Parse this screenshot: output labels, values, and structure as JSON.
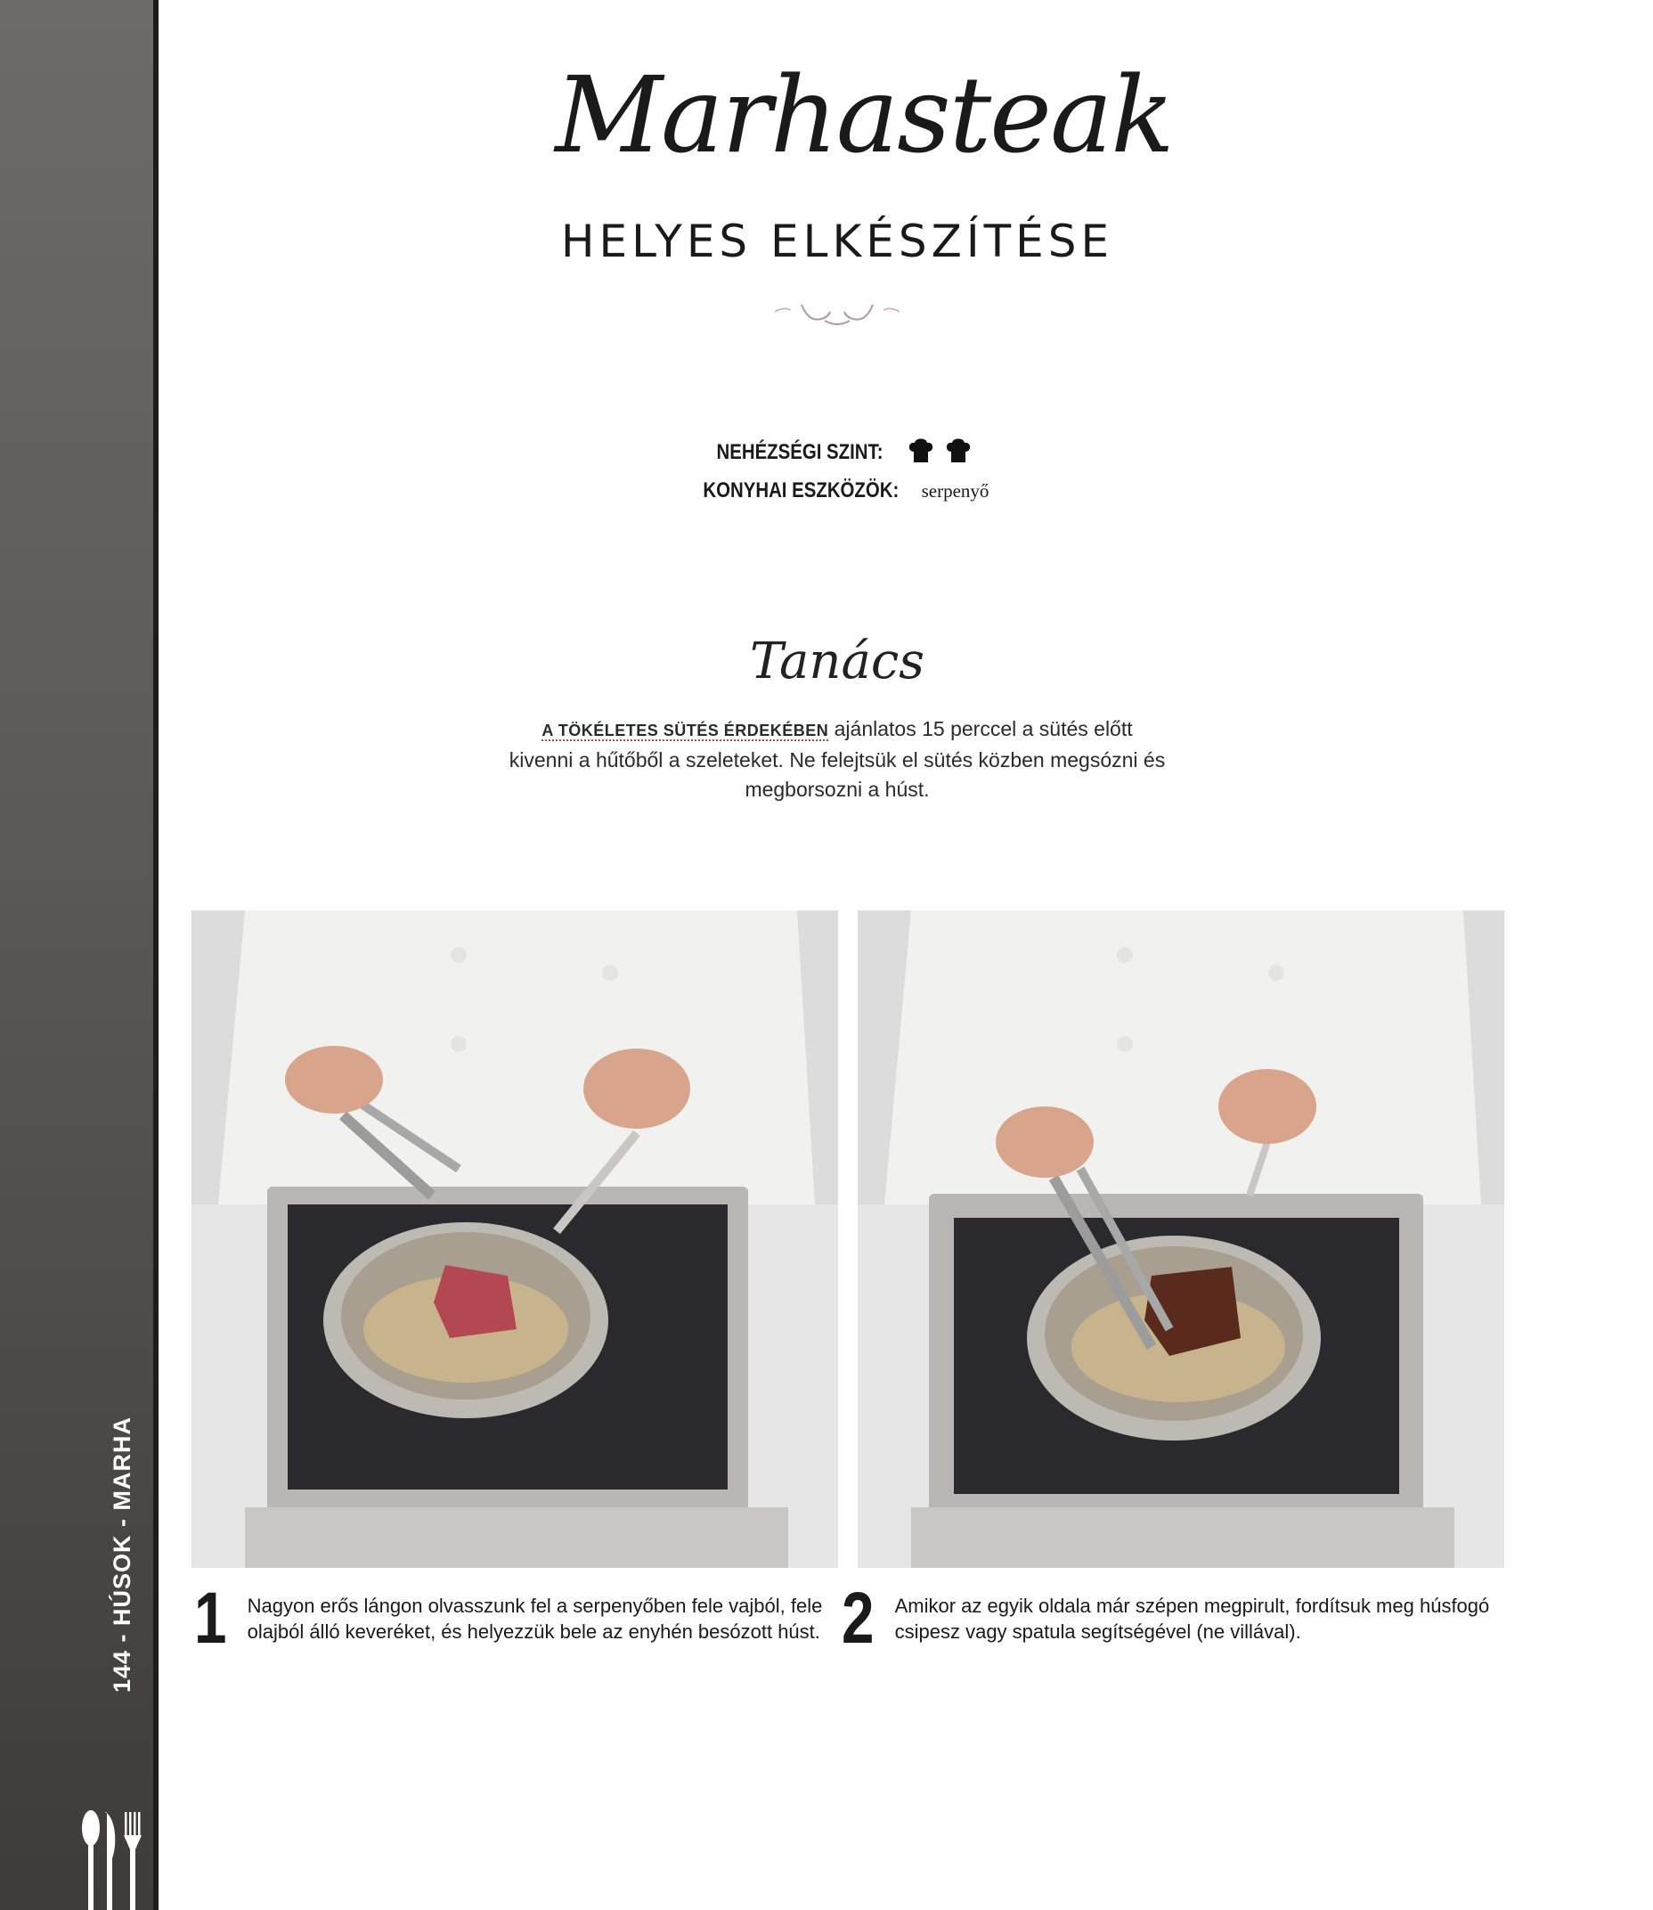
{
  "sidebar": {
    "section_label": "144 - HÚSOK - MARHA"
  },
  "header": {
    "title_script": "Marhasteak",
    "title_sub": "HELYES ELKÉSZÍTÉSE"
  },
  "meta": {
    "difficulty_label": "NEHÉZSÉGI SZINT:",
    "difficulty_level": 2,
    "tools_label": "KONYHAI ESZKÖZÖK:",
    "tools_value": "serpenyő"
  },
  "tip": {
    "heading": "Tanács",
    "lead": "A TÖKÉLETES SÜTÉS ÉRDEKÉBEN",
    "text": "ajánlatos 15 perccel a sütés előtt kivenni a hűtőből a szeleteket. Ne felejtsük el sütés közben megsózni és megborsozni a húst."
  },
  "steps": [
    {
      "number": "1",
      "text": "Nagyon erős lángon olvasszunk fel a serpenyőben fele vajból, fele olajból álló keveréket, és helyezzük bele az enyhén besózott húst."
    },
    {
      "number": "2",
      "text": "Amikor az egyik oldala már szépen megpirult, fordítsuk meg hús­fogó csipesz vagy spatula segítségével (ne villával)."
    }
  ]
}
